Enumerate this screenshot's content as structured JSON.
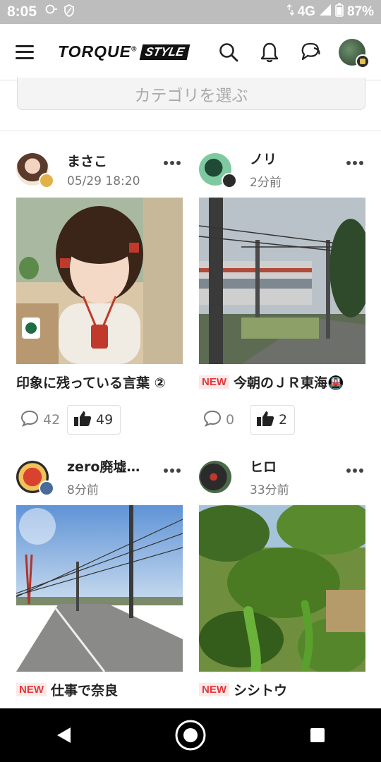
{
  "status_bar": {
    "time": "8:05",
    "network": "4G",
    "battery": "87%"
  },
  "header": {
    "logo_main": "TORQUE",
    "logo_reg": "®",
    "logo_sub": "STYLE"
  },
  "category": {
    "placeholder": "カテゴリを選ぶ"
  },
  "posts": [
    {
      "user": "まさこ",
      "time": "05/29 18:20",
      "is_new": false,
      "new_label": "",
      "title": "印象に残っている言葉 ②",
      "comments": "42",
      "likes": "49"
    },
    {
      "user": "ノリ",
      "time": "2分前",
      "is_new": true,
      "new_label": "NEW",
      "title": "今朝のＪＲ東海🚇",
      "comments": "0",
      "likes": "2"
    },
    {
      "user": "zero廃墟…",
      "time": "8分前",
      "is_new": true,
      "new_label": "NEW",
      "title": "仕事で奈良"
    },
    {
      "user": "ヒロ",
      "time": "33分前",
      "is_new": true,
      "new_label": "NEW",
      "title": "シシトウ"
    }
  ],
  "colors": {
    "new_badge_bg": "#fde8e8",
    "new_badge_text": "#e0383b",
    "status_bar": "#bdbdbd"
  }
}
